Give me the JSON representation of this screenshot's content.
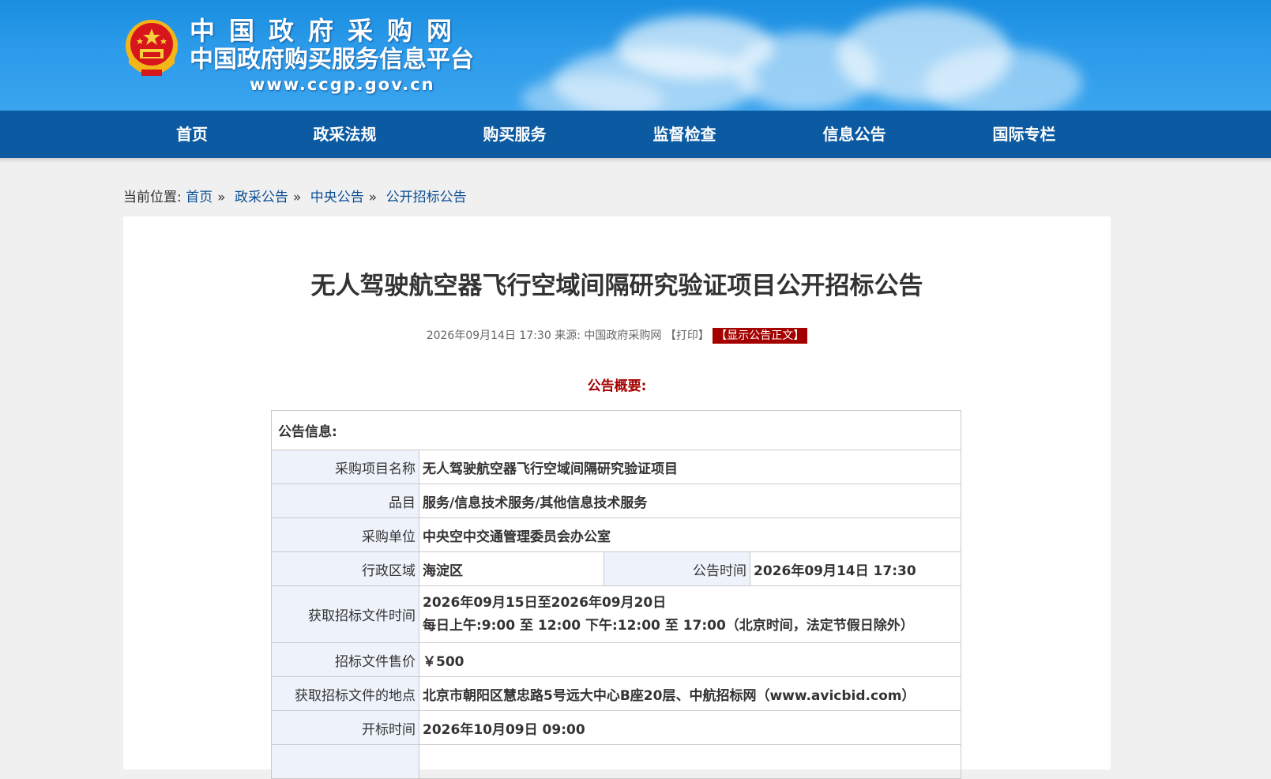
{
  "header": {
    "site_name": "中国政府采购网",
    "site_subtitle": "中国政府购买服务信息平台",
    "site_url": "www.ccgp.gov.cn"
  },
  "nav": {
    "items": [
      {
        "label": "首页"
      },
      {
        "label": "政采法规"
      },
      {
        "label": "购买服务"
      },
      {
        "label": "监督检查"
      },
      {
        "label": "信息公告"
      },
      {
        "label": "国际专栏"
      }
    ]
  },
  "breadcrumb": {
    "prefix": "当前位置:",
    "items": [
      "首页",
      "政采公告",
      "中央公告",
      "公开招标公告"
    ],
    "separator": "»"
  },
  "article": {
    "title": "无人驾驶航空器飞行空域间隔研究验证项目公开招标公告",
    "datetime": "2026年09月14日 17:30",
    "source_label": "来源:",
    "source": "中国政府采购网",
    "print_label": "【打印】",
    "show_text_label": "【显示公告正文】",
    "summary_heading": "公告概要:"
  },
  "info_table": {
    "header": "公告信息:",
    "project_name_label": "采购项目名称",
    "project_name": "无人驾驶航空器飞行空域间隔研究验证项目",
    "category_label": "品目",
    "category": "服务/信息技术服务/其他信息技术服务",
    "purchaser_label": "采购单位",
    "purchaser": "中央空中交通管理委员会办公室",
    "region_label": "行政区域",
    "region": "海淀区",
    "announce_time_label": "公告时间",
    "announce_time": "2026年09月14日 17:30",
    "doc_time_label": "获取招标文件时间",
    "doc_time_line1": "2026年09月15日至2026年09月20日",
    "doc_time_line2": "每日上午:9:00 至 12:00  下午:12:00 至 17:00（北京时间，法定节假日除外）",
    "doc_price_label": "招标文件售价",
    "doc_price": "￥500",
    "doc_location_label": "获取招标文件的地点",
    "doc_location": "北京市朝阳区慧忠路5号远大中心B座20层、中航招标网（www.avicbid.com）",
    "opening_time_label": "开标时间",
    "opening_time": "2026年10月09日 09:00"
  }
}
